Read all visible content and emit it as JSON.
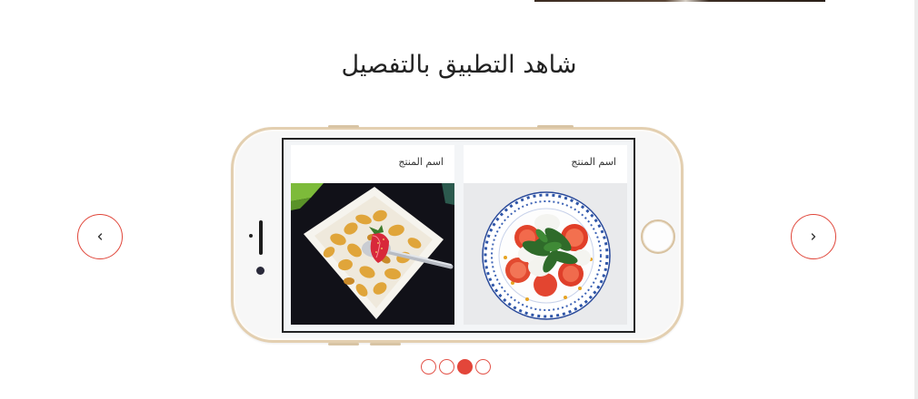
{
  "section": {
    "title": "شاهد التطبيق بالتفصيل"
  },
  "carousel": {
    "prev_icon": "chevron-left-icon",
    "next_icon": "chevron-right-icon",
    "cards": [
      {
        "label": "اسم المنتج",
        "image": "salad-photo"
      },
      {
        "label": "اسم المنتج",
        "image": "cereal-bowl-photo"
      }
    ],
    "dots_count": 4,
    "active_dot": 3
  },
  "colors": {
    "accent": "#e3463a",
    "phone_gold": "#e3cfb0"
  }
}
